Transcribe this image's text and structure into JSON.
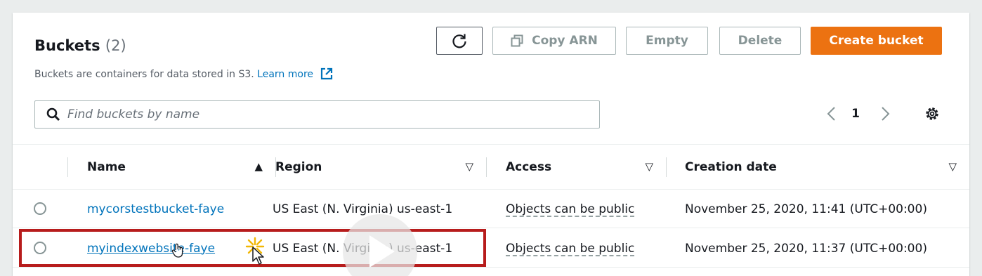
{
  "header": {
    "title": "Buckets",
    "count": "(2)",
    "description": "Buckets are containers for data stored in S3.",
    "learn_more": "Learn more"
  },
  "toolbar": {
    "refresh_icon": "refresh-icon",
    "copy_arn": "Copy ARN",
    "empty": "Empty",
    "delete": "Delete",
    "create_bucket": "Create bucket"
  },
  "search": {
    "placeholder": "Find buckets by name",
    "value": ""
  },
  "pagination": {
    "current_page": "1"
  },
  "table": {
    "columns": [
      {
        "label": "Name",
        "sort": "▲"
      },
      {
        "label": "Region",
        "sort": "▽"
      },
      {
        "label": "Access",
        "sort": "▽"
      },
      {
        "label": "Creation date",
        "sort": "▽"
      }
    ],
    "rows": [
      {
        "name": "mycorstestbucket-faye",
        "region": "US East (N. Virginia) us-east-1",
        "access": "Objects can be public",
        "created": "November 25, 2020, 11:41 (UTC+00:00)"
      },
      {
        "name": "myindexwebsite-faye",
        "region": "US East (N. Virginia) us-east-1",
        "access": "Objects can be public",
        "created": "November 25, 2020, 11:37 (UTC+00:00)"
      }
    ]
  },
  "colors": {
    "accent": "#ec7211",
    "link": "#0073bb",
    "highlight": "#b71c1c"
  }
}
